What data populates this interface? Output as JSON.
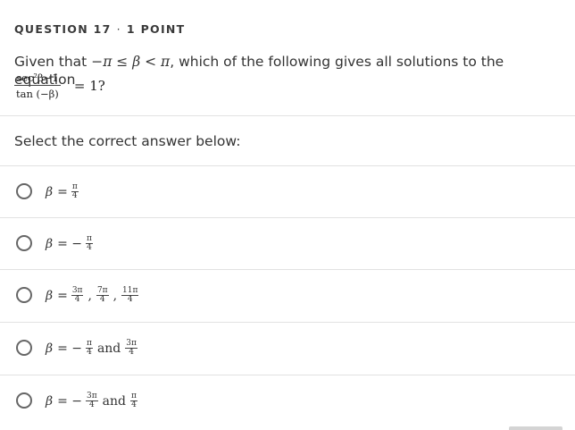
{
  "header": {
    "question_label": "QUESTION 17",
    "separator": "·",
    "points": "1 POINT"
  },
  "question": {
    "intro": "Given that",
    "condition": "−π ≤ β < π",
    "middle": ", which of the following gives all solutions to the equation",
    "fraction_numerator": "sec²β−1",
    "fraction_denominator": "tan (−β)",
    "equals": "= 1?"
  },
  "prompt": "Select the correct answer below:",
  "options": [
    {
      "var": "β",
      "eq": "=",
      "parts": [
        {
          "type": "frac",
          "num": "π",
          "den": "4"
        }
      ]
    },
    {
      "var": "β",
      "eq": "= −",
      "parts": [
        {
          "type": "frac",
          "num": "π",
          "den": "4"
        }
      ]
    },
    {
      "var": "β",
      "eq": "=",
      "parts": [
        {
          "type": "frac",
          "num": "3π",
          "den": "4"
        },
        {
          "type": "text",
          "text": ","
        },
        {
          "type": "frac",
          "num": "7π",
          "den": "4"
        },
        {
          "type": "text",
          "text": ","
        },
        {
          "type": "frac",
          "num": "11π",
          "den": "4"
        }
      ]
    },
    {
      "var": "β",
      "eq": "= −",
      "parts": [
        {
          "type": "frac",
          "num": "π",
          "den": "4"
        },
        {
          "type": "text",
          "text": "and"
        },
        {
          "type": "frac",
          "num": "3π",
          "den": "4"
        }
      ]
    },
    {
      "var": "β",
      "eq": "= −",
      "parts": [
        {
          "type": "frac",
          "num": "3π",
          "den": "4"
        },
        {
          "type": "text",
          "text": "and"
        },
        {
          "type": "frac",
          "num": "π",
          "den": "4"
        }
      ]
    }
  ]
}
